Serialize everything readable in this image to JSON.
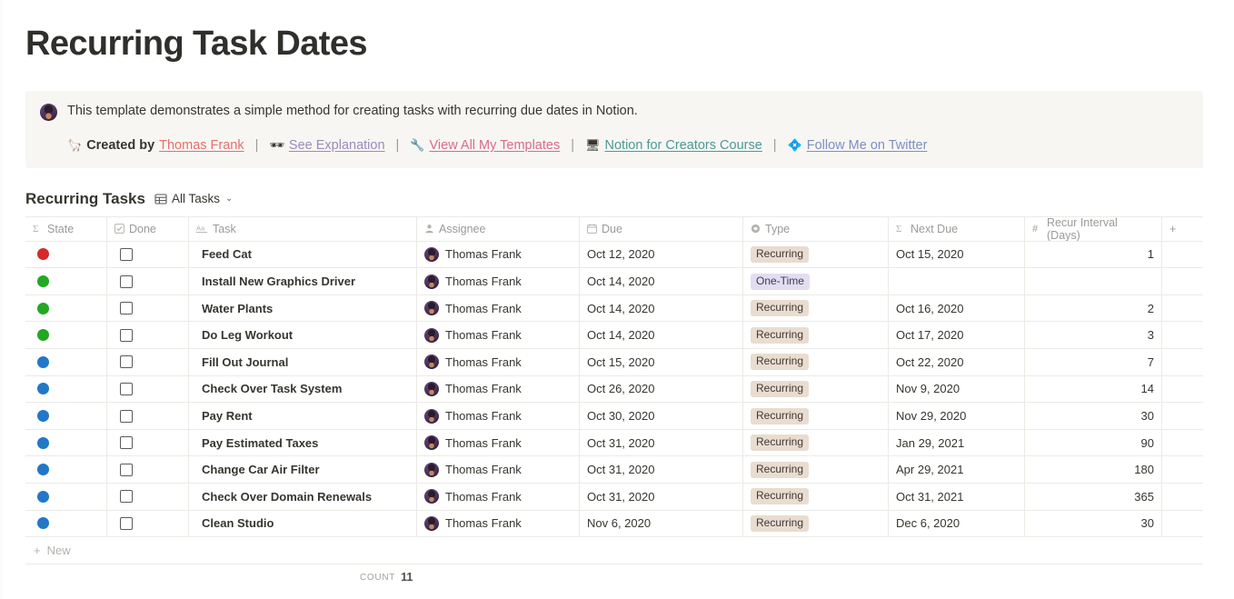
{
  "page_title": "Recurring Task Dates",
  "callout": {
    "avatar_icon": "user-avatar",
    "text": "This template demonstrates a simple method for creating tasks with recurring due dates in Notion.",
    "links": [
      {
        "emoji": "🦙",
        "prefix": "Created by",
        "label": "Thomas Frank",
        "color": "red"
      },
      {
        "emoji": "🕶",
        "prefix": "",
        "label": "See Explanation",
        "color": "purp"
      },
      {
        "emoji": "🔧",
        "prefix": "",
        "label": "View All My Templates",
        "color": "pink"
      },
      {
        "emoji": "🖥",
        "prefix": "",
        "label": "Notion for Creators Course",
        "color": "teal"
      },
      {
        "emoji": "💠",
        "prefix": "",
        "label": "Follow Me on Twitter",
        "color": "blue2"
      }
    ],
    "separator": "|"
  },
  "database": {
    "title": "Recurring Tasks",
    "view_icon": "table-icon",
    "view_name": "All Tasks",
    "chevron": "⌄",
    "add_column_label": "+",
    "new_row_label": "New",
    "new_row_plus": "+",
    "count_label": "COUNT",
    "count_value": "11",
    "columns": [
      {
        "label": "State",
        "icon": "sigma-icon"
      },
      {
        "label": "Done",
        "icon": "checkbox-icon"
      },
      {
        "label": "Task",
        "icon": "text-icon"
      },
      {
        "label": "Assignee",
        "icon": "person-icon"
      },
      {
        "label": "Due",
        "icon": "calendar-icon"
      },
      {
        "label": "Type",
        "icon": "select-icon"
      },
      {
        "label": "Next Due",
        "icon": "sigma-icon"
      },
      {
        "label": "Recur Interval (Days)",
        "icon": "number-icon"
      }
    ],
    "colors": {
      "state_red": "#d62a2a",
      "state_green": "#22a822",
      "state_blue": "#2277c8",
      "tag_recurring_bg": "#e9dcd0",
      "tag_onetime_bg": "#e3ddf2"
    },
    "rows": [
      {
        "state": "red",
        "done": false,
        "task": "Feed Cat",
        "assignee": "Thomas Frank",
        "due": "Oct 12, 2020",
        "type": "Recurring",
        "next_due": "Oct 15, 2020",
        "recur": "1"
      },
      {
        "state": "green",
        "done": false,
        "task": "Install New Graphics Driver",
        "assignee": "Thomas Frank",
        "due": "Oct 14, 2020",
        "type": "One-Time",
        "next_due": "",
        "recur": ""
      },
      {
        "state": "green",
        "done": false,
        "task": "Water Plants",
        "assignee": "Thomas Frank",
        "due": "Oct 14, 2020",
        "type": "Recurring",
        "next_due": "Oct 16, 2020",
        "recur": "2"
      },
      {
        "state": "green",
        "done": false,
        "task": "Do Leg Workout",
        "assignee": "Thomas Frank",
        "due": "Oct 14, 2020",
        "type": "Recurring",
        "next_due": "Oct 17, 2020",
        "recur": "3"
      },
      {
        "state": "blue",
        "done": false,
        "task": "Fill Out Journal",
        "assignee": "Thomas Frank",
        "due": "Oct 15, 2020",
        "type": "Recurring",
        "next_due": "Oct 22, 2020",
        "recur": "7"
      },
      {
        "state": "blue",
        "done": false,
        "task": "Check Over Task System",
        "assignee": "Thomas Frank",
        "due": "Oct 26, 2020",
        "type": "Recurring",
        "next_due": "Nov 9, 2020",
        "recur": "14"
      },
      {
        "state": "blue",
        "done": false,
        "task": "Pay Rent",
        "assignee": "Thomas Frank",
        "due": "Oct 30, 2020",
        "type": "Recurring",
        "next_due": "Nov 29, 2020",
        "recur": "30"
      },
      {
        "state": "blue",
        "done": false,
        "task": "Pay Estimated Taxes",
        "assignee": "Thomas Frank",
        "due": "Oct 31, 2020",
        "type": "Recurring",
        "next_due": "Jan 29, 2021",
        "recur": "90"
      },
      {
        "state": "blue",
        "done": false,
        "task": "Change Car Air Filter",
        "assignee": "Thomas Frank",
        "due": "Oct 31, 2020",
        "type": "Recurring",
        "next_due": "Apr 29, 2021",
        "recur": "180"
      },
      {
        "state": "blue",
        "done": false,
        "task": "Check Over Domain Renewals",
        "assignee": "Thomas Frank",
        "due": "Oct 31, 2020",
        "type": "Recurring",
        "next_due": "Oct 31, 2021",
        "recur": "365"
      },
      {
        "state": "blue",
        "done": false,
        "task": "Clean Studio",
        "assignee": "Thomas Frank",
        "due": "Nov 6, 2020",
        "type": "Recurring",
        "next_due": "Dec 6, 2020",
        "recur": "30"
      }
    ]
  }
}
